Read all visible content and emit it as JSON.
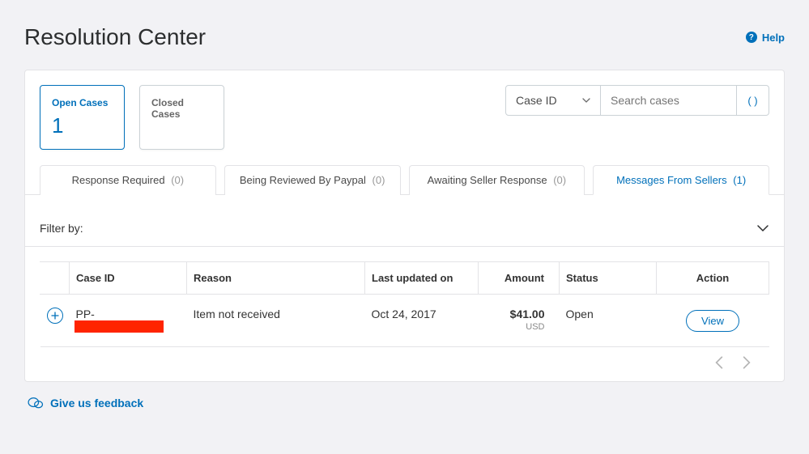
{
  "header": {
    "title": "Resolution Center",
    "help_label": "Help"
  },
  "stat_cards": {
    "open": {
      "label": "Open Cases",
      "count": "1"
    },
    "closed": {
      "label": "Closed Cases",
      "count": ""
    }
  },
  "search": {
    "select_label": "Case ID",
    "placeholder": "Search cases",
    "button_glyph": "( )"
  },
  "tabs": {
    "response_required": {
      "label": "Response Required",
      "count": "(0)"
    },
    "being_reviewed": {
      "label": "Being Reviewed By Paypal",
      "count": "(0)"
    },
    "awaiting_seller": {
      "label": "Awaiting Seller Response",
      "count": "(0)"
    },
    "messages": {
      "label": "Messages From Sellers",
      "count": "(1)"
    }
  },
  "filter": {
    "label": "Filter by:"
  },
  "table": {
    "headers": {
      "case_id": "Case ID",
      "reason": "Reason",
      "last_updated": "Last updated on",
      "amount": "Amount",
      "status": "Status",
      "action": "Action"
    },
    "rows": [
      {
        "case_id_prefix": "PP-",
        "reason": "Item not received",
        "last_updated": "Oct 24, 2017",
        "amount": "$41.00",
        "currency": "USD",
        "status": "Open",
        "action_label": "View"
      }
    ]
  },
  "feedback": {
    "label": "Give us feedback"
  }
}
